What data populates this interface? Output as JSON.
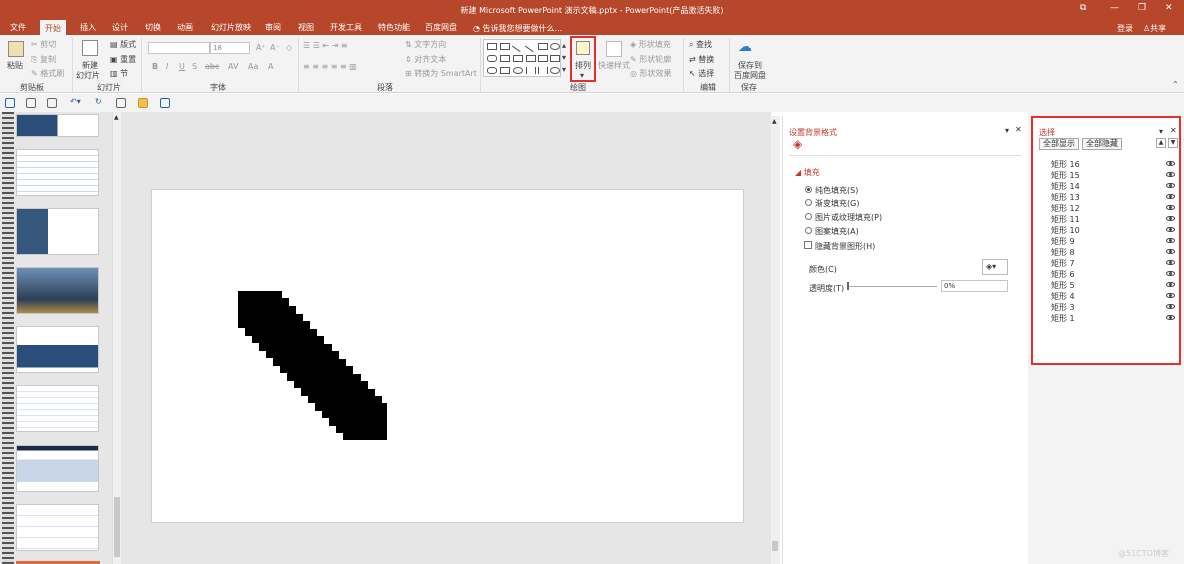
{
  "window": {
    "title": "新建 Microsoft PowerPoint 演示文稿.pptx - PowerPoint(产品激活失败)",
    "controls": [
      "restore-icon",
      "minimize-icon",
      "maximize-icon",
      "close-icon"
    ]
  },
  "tabs": [
    "文件",
    "开始",
    "插入",
    "设计",
    "切换",
    "动画",
    "幻灯片放映",
    "审阅",
    "视图",
    "开发工具",
    "特色功能",
    "百度网盘"
  ],
  "active_tab": "开始",
  "tell_me": "告诉我您想要做什么...",
  "account": {
    "login": "登录",
    "share": "共享"
  },
  "ribbon": {
    "clipboard": {
      "paste": "粘贴",
      "cut": "剪切",
      "copy": "复制",
      "format_painter": "格式刷",
      "group": "剪贴板"
    },
    "slides": {
      "new_slide": "新建",
      "new_slide2": "幻灯片",
      "layout": "版式",
      "reset": "重置",
      "section": "节",
      "group": "幻灯片"
    },
    "font": {
      "font_name": "",
      "font_size": "18",
      "group": "字体",
      "bold": "B",
      "italic": "I",
      "underline": "U",
      "strike": "S",
      "shadow": "abc",
      "spacing": "AV",
      "case": "Aa",
      "color": "A"
    },
    "paragraph": {
      "text_direction": "文字方向",
      "align_text": "对齐文本",
      "smartart": "转换为 SmartArt",
      "group": "段落"
    },
    "drawing": {
      "arrange": "排列",
      "quick_styles": "快速样式",
      "shape_fill": "形状填充",
      "shape_outline": "形状轮廓",
      "shape_effects": "形状效果",
      "group": "绘图"
    },
    "editing": {
      "find": "查找",
      "replace": "替换",
      "select": "选择",
      "group": "编辑"
    },
    "save": {
      "save_to": "保存到",
      "baidu": "百度网盘",
      "group": "保存"
    }
  },
  "format_background": {
    "title": "设置背景格式",
    "fill_section": "填充",
    "options": [
      {
        "label": "纯色填充(S)",
        "selected": true
      },
      {
        "label": "渐变填充(G)",
        "selected": false
      },
      {
        "label": "图片或纹理填充(P)",
        "selected": false
      },
      {
        "label": "图案填充(A)",
        "selected": false
      }
    ],
    "hide_bg": "隐藏背景图形(H)",
    "color_label": "颜色(C)",
    "transparency_label": "透明度(T)",
    "transparency_value": "0%"
  },
  "selection_pane": {
    "title": "选择",
    "show_all": "全部显示",
    "hide_all": "全部隐藏",
    "items": [
      "矩形 16",
      "矩形 15",
      "矩形 14",
      "矩形 13",
      "矩形 12",
      "矩形 11",
      "矩形 10",
      "矩形 9",
      "矩形 8",
      "矩形 7",
      "矩形 6",
      "矩形 5",
      "矩形 4",
      "矩形 3",
      "矩形 1"
    ]
  },
  "watermark": "@51CTO博客"
}
